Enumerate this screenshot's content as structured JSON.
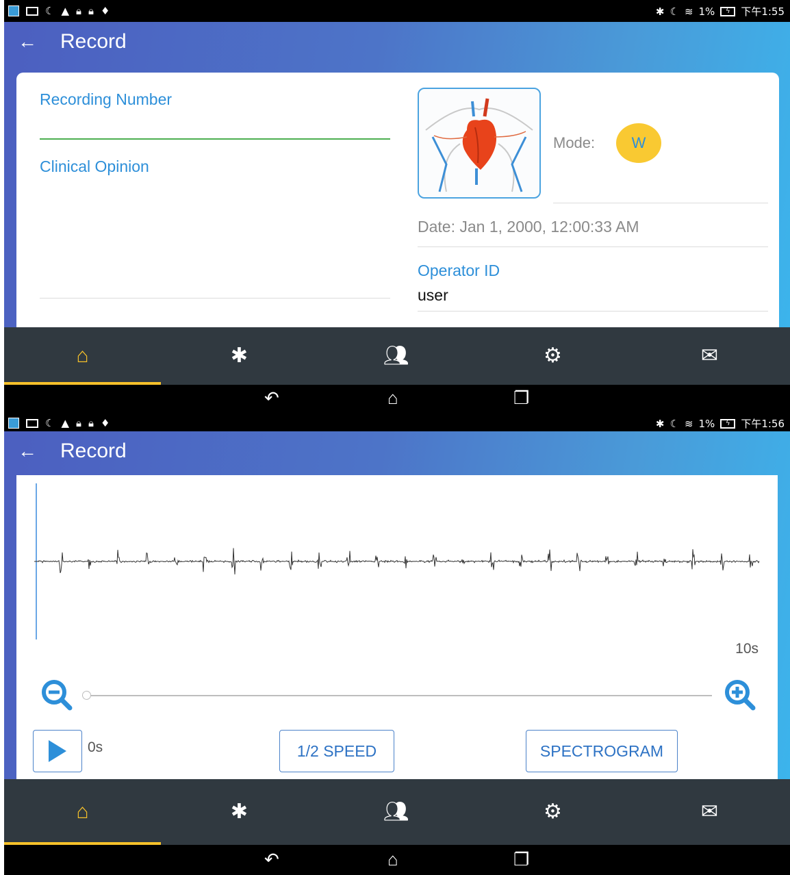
{
  "status_bar_1": {
    "time": "下午1:55",
    "battery": "1%"
  },
  "status_bar_2": {
    "time": "下午1:56",
    "battery": "1%"
  },
  "appbar": {
    "title": "Record"
  },
  "record_form": {
    "recording_number_label": "Recording Number",
    "recording_number_value": "",
    "clinical_opinion_label": "Clinical Opinion",
    "mode_label": "Mode:",
    "mode_value": "W",
    "date_text": "Date: Jan 1, 2000, 12:00:33 AM",
    "operator_id_label": "Operator ID",
    "operator_id_value": "user"
  },
  "waveform_view": {
    "end_time_label": "10s",
    "current_time_label": "0s",
    "zoom_position": 0,
    "half_speed_label": "1/2 SPEED",
    "spectrogram_label": "SPECTROGRAM"
  },
  "bottom_nav": {
    "items": [
      {
        "icon": "home-icon",
        "active": true
      },
      {
        "icon": "bluetooth-icon",
        "active": false
      },
      {
        "icon": "people-icon",
        "active": false
      },
      {
        "icon": "settings-icon",
        "active": false
      },
      {
        "icon": "mail-icon",
        "active": false
      }
    ]
  },
  "colors": {
    "accent": "#f6c12a",
    "label_blue": "#2d8fd9",
    "nav_bg": "#303940",
    "input_underline": "#4caf50"
  }
}
